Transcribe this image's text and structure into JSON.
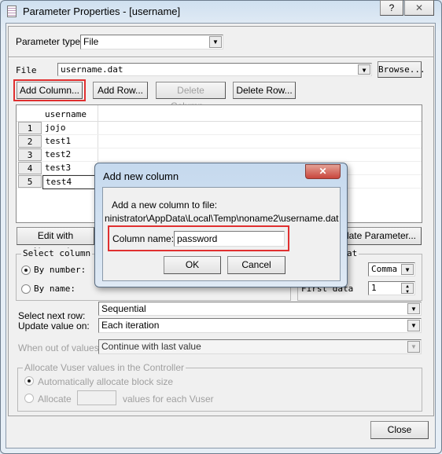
{
  "window": {
    "title": "Parameter Properties - [username]",
    "help_label": "?",
    "close_label": "✕"
  },
  "param_type": {
    "label": "Parameter type:",
    "value": "File"
  },
  "file": {
    "label": "File",
    "value": "username.dat",
    "browse": "Browse..."
  },
  "toolbar": {
    "add_column": "Add Column...",
    "add_row": "Add Row...",
    "delete_column": "Delete Column...",
    "delete_row": "Delete Row..."
  },
  "grid": {
    "header": "username",
    "rows": [
      {
        "n": "1",
        "v": "jojo"
      },
      {
        "n": "2",
        "v": "test1"
      },
      {
        "n": "3",
        "v": "test2"
      },
      {
        "n": "4",
        "v": "test3"
      },
      {
        "n": "5",
        "v": "test4"
      }
    ]
  },
  "edit_notepad": "Edit with Notepad...",
  "simulate": "mulate Parameter...",
  "select_column": {
    "title": "Select column",
    "by_number": "By number:",
    "by_name": "By name:"
  },
  "file_format": {
    "title": "at",
    "delimiter": "Comma",
    "first_data_label": "First data",
    "first_data": "1"
  },
  "select_next_row": {
    "label": "Select next row:",
    "value": "Sequential"
  },
  "update_value": {
    "label": "Update value on:",
    "value": "Each iteration"
  },
  "out_of_values": {
    "label": "When out of values:",
    "value": "Continue with last value"
  },
  "allocate": {
    "title": "Allocate Vuser values in the Controller",
    "auto": "Automatically allocate block size",
    "allocate": "Allocate",
    "suffix": "values for each Vuser"
  },
  "close": "Close",
  "dialog": {
    "title": "Add new column",
    "close_label": "✕",
    "intro": "Add a new column to file:",
    "path": "ninistrator\\AppData\\Local\\Temp\\noname2\\username.dat",
    "column_label": "Column name:",
    "column_value": "password",
    "ok": "OK",
    "cancel": "Cancel"
  },
  "colors": {
    "highlight": "#e03030",
    "dialog_close": "#c9463d"
  }
}
